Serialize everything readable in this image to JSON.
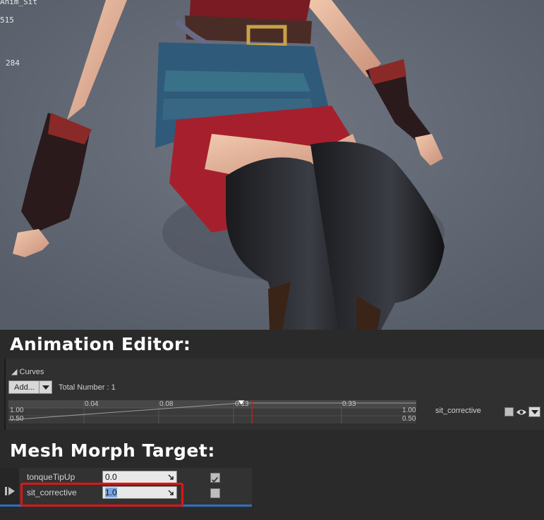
{
  "viewport": {
    "stats": [
      "Anim_Sit",
      "515",
      "284"
    ]
  },
  "titles": {
    "animation_editor": "Animation Editor:",
    "mesh_morph_target": "Mesh Morph Target:"
  },
  "curves": {
    "header": "Curves",
    "add_label": "Add...",
    "total_label": "Total Number : 1",
    "ticks_top": [
      "0.04",
      "0.08",
      "0.13",
      "0.33"
    ],
    "left_top": "1.00",
    "left_bottom": "0.50",
    "right_top": "1.00",
    "right_bottom": "0.50",
    "curve_name": "sit_corrective",
    "curve_enabled": false
  },
  "morph_targets": [
    {
      "name": "tonqueTipUp",
      "value": "0.0",
      "checked": true
    },
    {
      "name": "sit_corrective",
      "value": "1.0",
      "checked": false
    }
  ],
  "colors": {
    "highlight": "#e01414",
    "playhead": "#c81a1a",
    "accent_line": "#2e6fbf"
  }
}
